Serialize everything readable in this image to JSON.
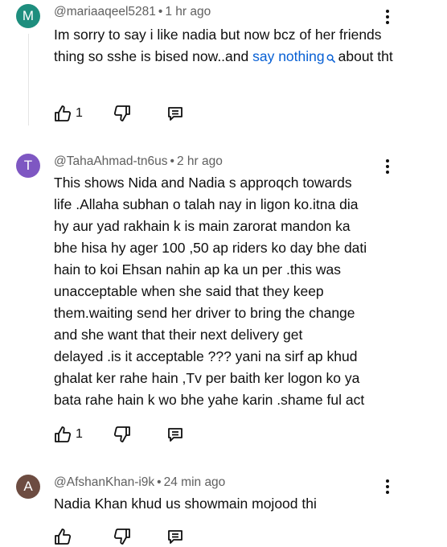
{
  "comments": [
    {
      "avatar_letter": "M",
      "avatar_color": "#1e8e7e",
      "username": "@mariaaqeel5281",
      "time": "1 hr ago",
      "text_before": "Im sorry to say i like nadia but now bcz of her friends thing so sshe is bised now..and ",
      "link_text": "say nothing",
      "text_after": "about tht",
      "like_count": "1"
    },
    {
      "avatar_letter": "T",
      "avatar_color": "#7e57c2",
      "username": "@TahaAhmad-tn6us",
      "time": "2 hr ago",
      "lines": [
        "This shows Nida and Nadia s approqch towards",
        "life .Allaha subhan o talah nay in ligon ko.itna dia",
        "hy aur yad rakhain k is main zarorat mandon ka",
        "bhe hisa hy ager 100 ,50 ap riders ko day bhe dati",
        "hain to koi Ehsan nahin ap ka un per .this was",
        "unacceptable when she said that they keep",
        "them.waiting send her driver to bring the change",
        "and she want that their next delivery get",
        "delayed .is it acceptable ??? yani na sirf ap khud",
        "ghalat ker rahe hain ,Tv per baith ker logon ko ya",
        "bata rahe hain k wo bhe yahe karin .shame ful act"
      ],
      "like_count": "1"
    },
    {
      "avatar_letter": "A",
      "avatar_color": "#6d4c41",
      "username": "@AfshanKhan-i9k",
      "time": "24 min ago",
      "text": "Nadia Khan khud us showmain mojood thi",
      "like_count": ""
    }
  ],
  "separator": "•",
  "icons": {
    "like": "thumbs-up-icon",
    "dislike": "thumbs-down-icon",
    "reply": "reply-comment-icon",
    "more": "more-vert-icon",
    "search": "search-icon"
  }
}
